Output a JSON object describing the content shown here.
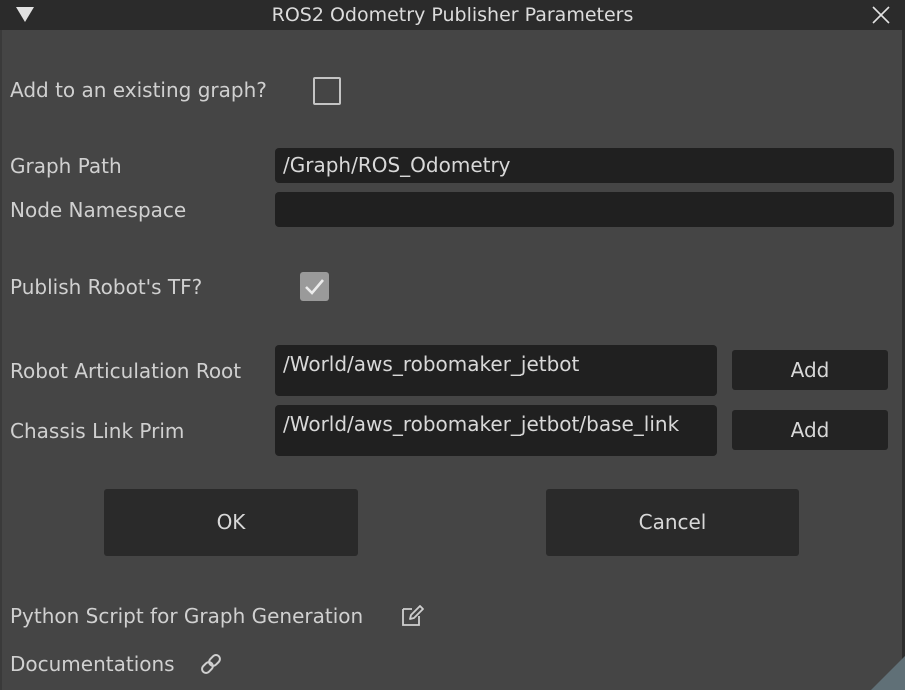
{
  "window": {
    "title": "ROS2 Odometry Publisher Parameters"
  },
  "form": {
    "add_existing_label": "Add to an existing graph?",
    "add_existing_checked": false,
    "graph_path_label": "Graph Path",
    "graph_path_value": "/Graph/ROS_Odometry",
    "node_namespace_label": "Node Namespace",
    "node_namespace_value": "",
    "publish_tf_label": "Publish Robot's TF?",
    "publish_tf_checked": true,
    "articulation_root_label": "Robot Articulation Root",
    "articulation_root_value": "/World/aws_robomaker_jetbot",
    "chassis_link_label": "Chassis Link Prim",
    "chassis_link_value": "/World/aws_robomaker_jetbot/base_link",
    "add_label": "Add"
  },
  "actions": {
    "ok_label": "OK",
    "cancel_label": "Cancel"
  },
  "footer": {
    "python_script_label": "Python Script for Graph Generation",
    "documentation_label": "Documentations"
  },
  "icons": {
    "collapse": "triangle-down-icon",
    "close": "close-icon",
    "checkmark": "checkmark-icon",
    "edit": "edit-icon",
    "link": "link-icon"
  },
  "colors": {
    "background": "#454545",
    "titlebar": "#2b2b2b",
    "field": "#202020",
    "button": "#2a2a2a",
    "text": "#d0d0d0"
  }
}
